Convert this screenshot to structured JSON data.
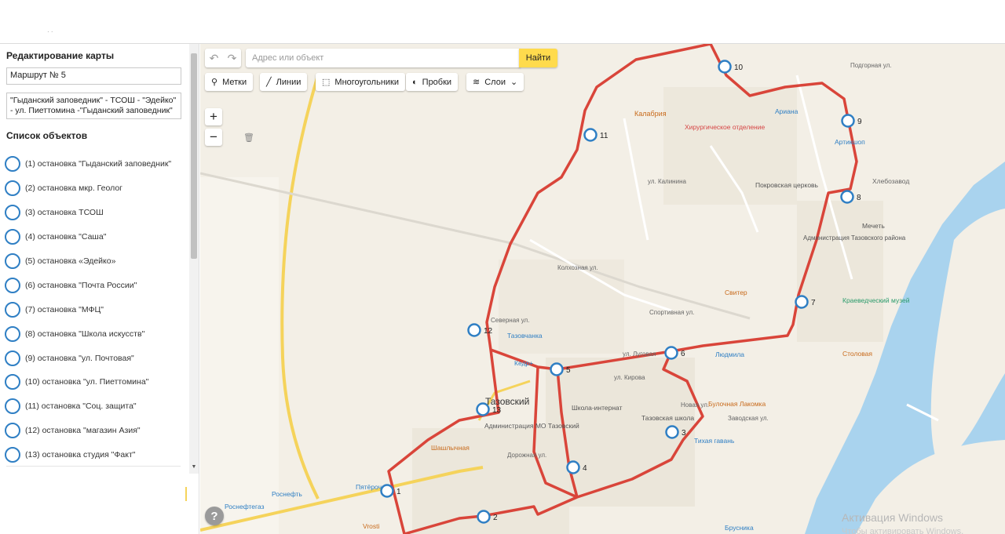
{
  "sidebar": {
    "title": "Редактирование карты",
    "route_name": "Маршрут № 5",
    "route_description": "\"Гыданский заповедник\" - ТСОШ - \"Эдейко\" - ул. Пиеттомина -\"Гыданский заповедник\"",
    "list_title": "Список объектов",
    "stops": [
      "(1) остановка \"Гыданский заповедник\"",
      "(2) остановка мкр. Геолог",
      "(3) остановка ТСОШ",
      "(4) остановка \"Саша\"",
      "(5) остановка «Эдейко»",
      "(6) остановка \"Почта России\"",
      "(7) остановка \"МФЦ\"",
      "(8) остановка \"Школа искусств\"",
      "(9) остановка \"ул. Почтовая\"",
      "(10) остановка \"ул. Пиеттомина\"",
      "(11) остановка \"Соц. защита\"",
      "(12) остановка \"магазин Азия\"",
      "(13) остановка студия \"Факт\""
    ]
  },
  "toolbar": {
    "undo_icon": "undo-icon",
    "redo_icon": "redo-icon",
    "search_placeholder": "Адрес или объект",
    "search_button": "Найти",
    "marks": "Метки",
    "lines": "Линии",
    "polygons": "Многоугольники",
    "traffic": "Пробки",
    "layers": "Слои"
  },
  "map": {
    "route_color": "#d9453a",
    "stop_color": "#2f7fc4",
    "water_color": "#a9d3ee",
    "labels": {
      "town": "Тазовский",
      "kalabriya": "Калабрия",
      "surgery": "Хирургическое отделение",
      "ariana": "Ариана",
      "artikshop": "Артикшоп",
      "hlebozavod": "Хлебозавод",
      "church": "Покровская церковь",
      "mosque": "Мечеть",
      "district_admin": "Администрация Тазовского района",
      "kraeved": "Краеведческий музей",
      "sviter": "Свитер",
      "stolovaya": "Столовая",
      "lyudmila": "Людмила",
      "tazovchanka": "Тазовчанка",
      "kedr": "Кедр+",
      "boarding_school": "Школа-интернат",
      "bulochnaya": "Булочная Лакомка",
      "tazov_school": "Тазовская школа",
      "tihaya": "Тихая гавань",
      "mo_admin": "Администрация МО Тазовский",
      "shashlychnaya": "Шашлычная",
      "pyaterochka": "Пятёрочка",
      "rosneft": "Роснефть",
      "rosneftegaz": "Роснефтегаз",
      "vrosti": "Vrosti",
      "brusnika": "Брусника",
      "st_kalinina": "ул. Калинина",
      "st_kolhoznaya": "Колхозная ул.",
      "st_sportivnaya": "Спортивная ул.",
      "st_lugovaya": "ул. Луговая",
      "st_kirova": "ул. Кирова",
      "st_novaya": "Новая ул.",
      "st_zavodskaya": "Заводская ул.",
      "st_dorozhnaya": "Дорожная ул.",
      "st_severnaya": "Северная ул.",
      "st_pochtovaya": "Подгорная ул."
    },
    "stop_numbers": [
      "1",
      "2",
      "3",
      "4",
      "5",
      "6",
      "7",
      "8",
      "9",
      "10",
      "11",
      "12",
      "13"
    ]
  },
  "help": "?",
  "watermark": "Активация Windows",
  "watermark_sub": "Чтобы активировать Windows, перейдите"
}
